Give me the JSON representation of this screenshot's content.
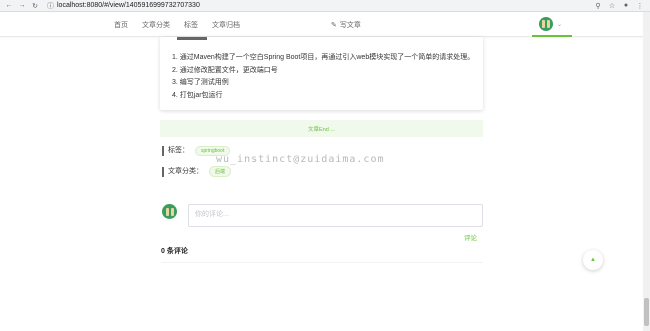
{
  "browser": {
    "url": "localhost:8080/#/view/1405916999732707330",
    "nav_icons": [
      "back-icon",
      "forward-icon",
      "reload-icon"
    ],
    "right_icons": [
      "key-icon",
      "star-icon",
      "profile-icon",
      "menu-icon"
    ]
  },
  "topnav": {
    "menu": [
      "首页",
      "文章分类",
      "标签",
      "文章归档"
    ],
    "write_label": "写文章",
    "accent": "#67c23a"
  },
  "article": {
    "steps": [
      "1. 通过Maven构建了一个空白Spring Boot项目，再通过引入web模块实现了一个简单的请求处理。",
      "2. 通过修改配置文件，更改端口号",
      "3. 编写了测试用例",
      "4. 打包jar包运行"
    ],
    "end_text": "文章End ...",
    "tags_label": "标签：",
    "tag": "springboot",
    "category_label": "文章分类：",
    "category": "后端"
  },
  "watermark": "wu_instinct@zuidaima.com",
  "comments": {
    "placeholder": "你的评论...",
    "submit_label": "评论",
    "count_label": "0 条评论"
  }
}
